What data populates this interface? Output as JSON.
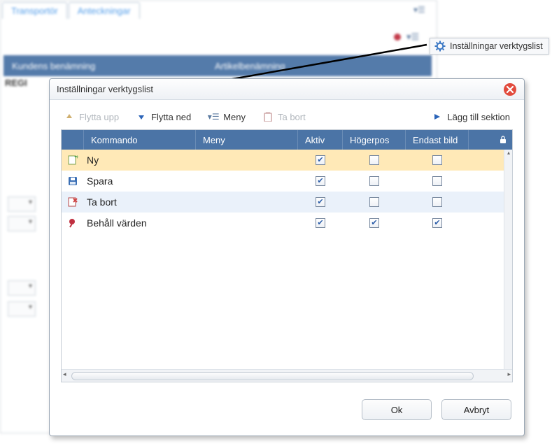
{
  "background": {
    "tabs": [
      "Transportör",
      "Anteckningar"
    ],
    "table_headers": [
      "Kundens benämning",
      "Artikelbenämning"
    ],
    "row_prefix": "REGI"
  },
  "callout": {
    "label": "Inställningar verktygslist"
  },
  "dialog": {
    "title": "Inställningar verktygslist",
    "toolbar": {
      "move_up": "Flytta upp",
      "move_down": "Flytta ned",
      "menu": "Meny",
      "delete": "Ta bort",
      "add_section": "Lägg till sektion"
    },
    "columns": {
      "kommando": "Kommando",
      "meny": "Meny",
      "aktiv": "Aktiv",
      "hogerpos": "Högerpos",
      "endast_bild": "Endast bild"
    },
    "rows": [
      {
        "icon": "new",
        "kommando": "Ny",
        "aktiv": true,
        "hogerpos": false,
        "endast_bild": false,
        "selected": true
      },
      {
        "icon": "save",
        "kommando": "Spara",
        "aktiv": true,
        "hogerpos": false,
        "endast_bild": false,
        "selected": false
      },
      {
        "icon": "delete",
        "kommando": "Ta bort",
        "aktiv": true,
        "hogerpos": false,
        "endast_bild": false,
        "selected": false
      },
      {
        "icon": "pin",
        "kommando": "Behåll värden",
        "aktiv": true,
        "hogerpos": true,
        "endast_bild": true,
        "selected": false
      }
    ],
    "buttons": {
      "ok": "Ok",
      "cancel": "Avbryt"
    }
  }
}
